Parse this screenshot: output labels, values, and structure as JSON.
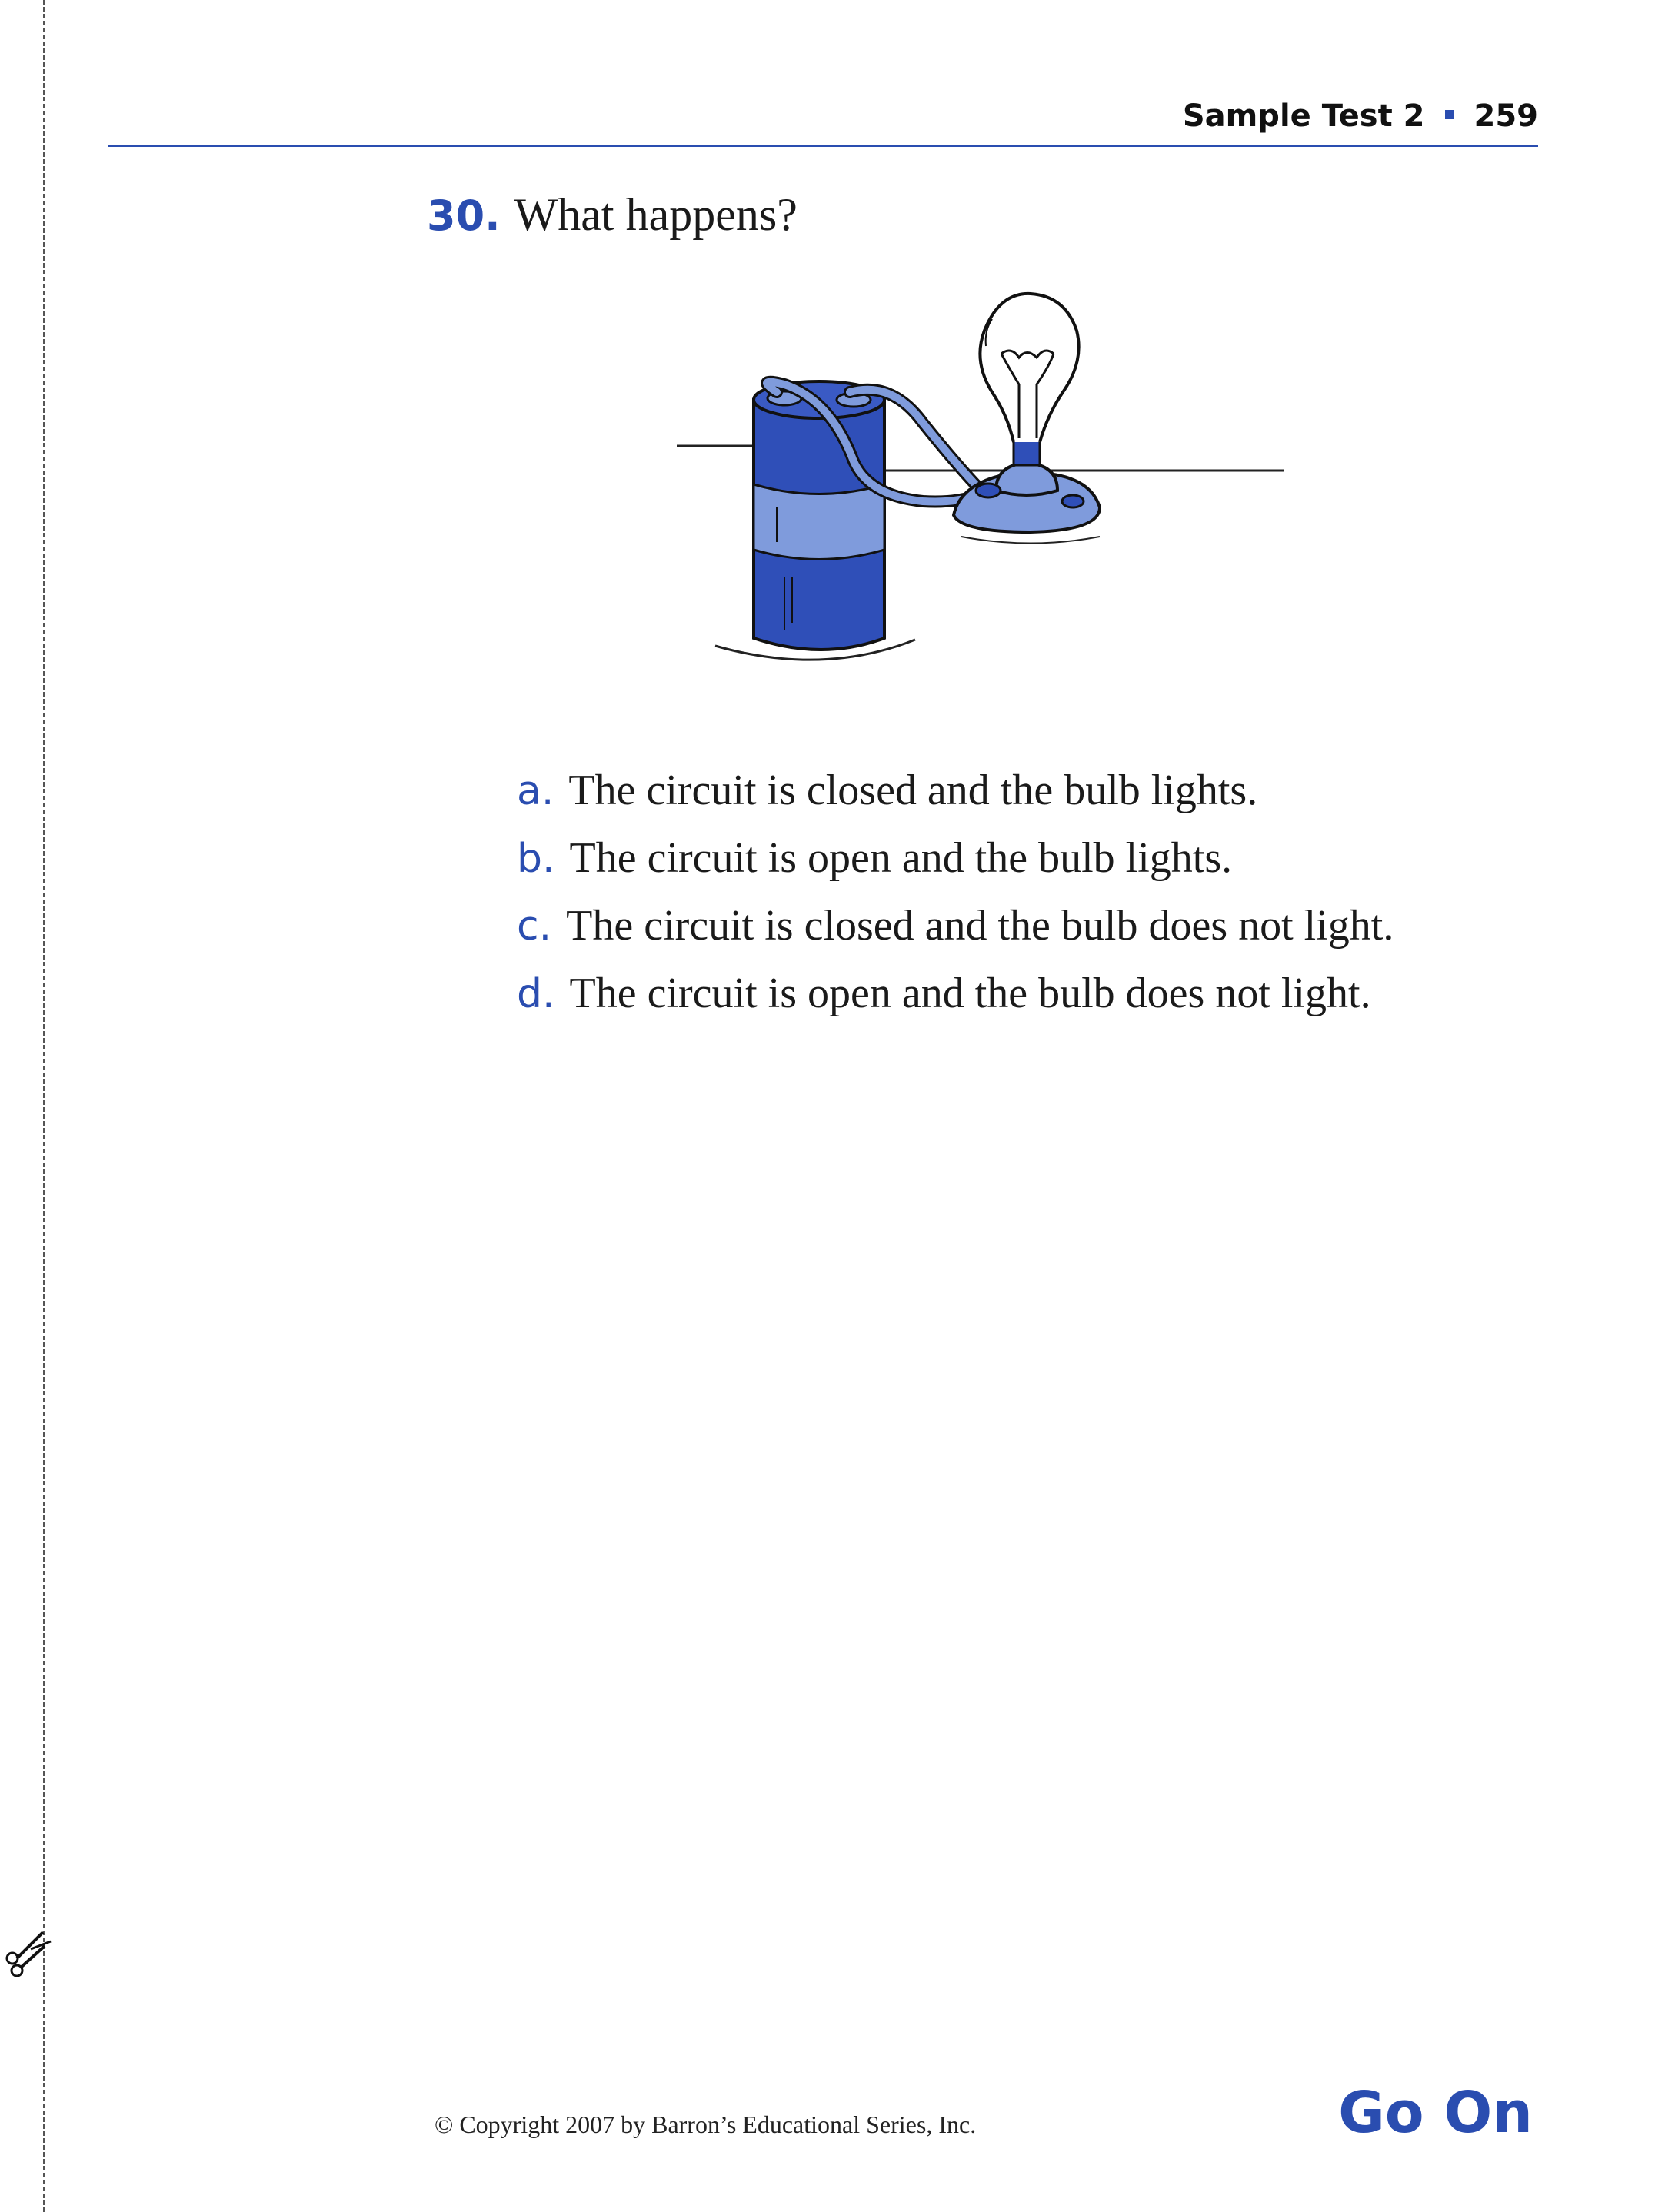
{
  "header": {
    "section": "Sample Test 2",
    "page_number": "259"
  },
  "question": {
    "number": "30.",
    "text": "What happens?"
  },
  "choices": [
    {
      "letter": "a.",
      "text": "The circuit is closed and the bulb lights."
    },
    {
      "letter": "b.",
      "text": "The circuit is open and the bulb lights."
    },
    {
      "letter": "c.",
      "text": "The circuit is closed and the bulb does not light."
    },
    {
      "letter": "d.",
      "text": "The circuit is open and the bulb does not light."
    }
  ],
  "footer": {
    "copyright": "© Copyright 2007 by Barron’s Educational Series, Inc.",
    "go_on": "Go On"
  },
  "colors": {
    "accent": "#2a4db0",
    "battery_dark": "#2f4fb8",
    "battery_light": "#7f9bdc"
  },
  "icons": [
    "scissors-icon"
  ]
}
